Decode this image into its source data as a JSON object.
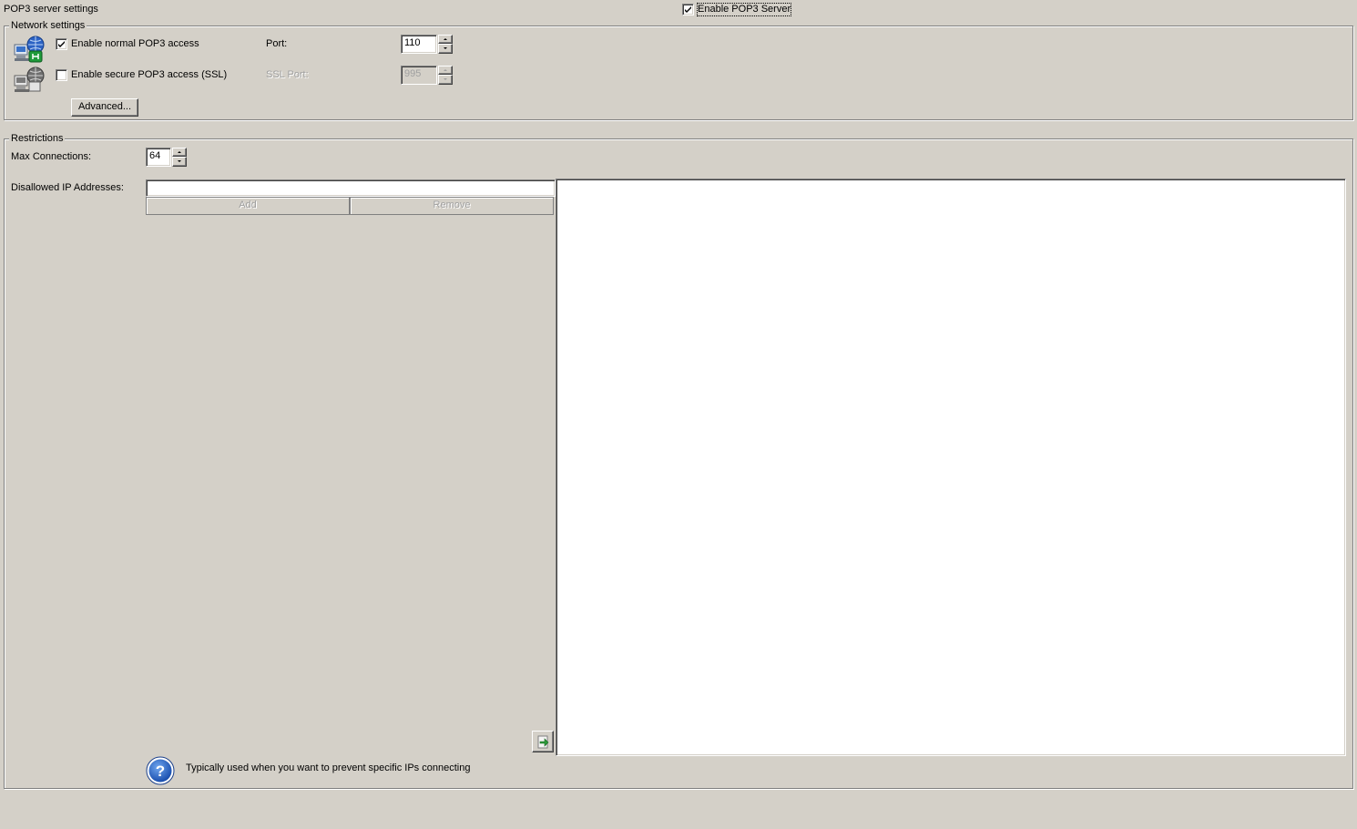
{
  "page": {
    "title": "POP3 server settings",
    "enable_server": {
      "label": "Enable POP3 Server",
      "checked": true
    }
  },
  "network": {
    "group_title": "Network settings",
    "normal": {
      "label": "Enable normal POP3 access",
      "checked": true,
      "port_label": "Port:",
      "port_value": "110"
    },
    "secure": {
      "label": "Enable secure POP3 access (SSL)",
      "checked": false,
      "port_label": "SSL Port:",
      "port_value": "995"
    },
    "advanced_label": "Advanced..."
  },
  "restrictions": {
    "group_title": "Restrictions",
    "max_connections_label": "Max Connections:",
    "max_connections_value": "64",
    "disallowed_label": "Disallowed IP Addresses:",
    "ip_input_value": "",
    "add_label": "Add",
    "remove_label": "Remove",
    "disallowed_list": [],
    "info_text": "Typically used when you want to prevent specific IPs connecting"
  },
  "icons": {
    "normal_access": "network-computer-icon",
    "secure_access": "network-computer-disabled-icon",
    "move_to_list": "arrow-right-icon",
    "info": "question-help-icon"
  },
  "colors": {
    "window_bg": "#d4d0c8",
    "shadow": "#808080",
    "highlight": "#ffffff",
    "disabled_text": "#a0a0a0",
    "icon_blue": "#1f56b5"
  }
}
